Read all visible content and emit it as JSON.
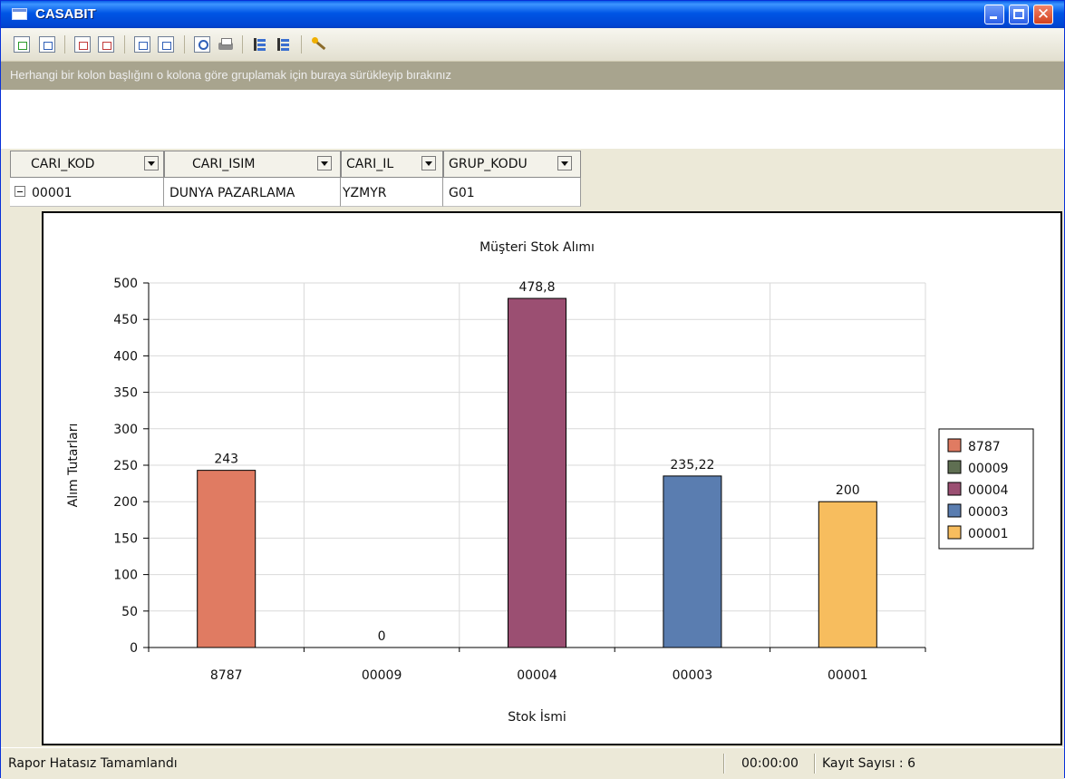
{
  "window": {
    "title": "CASABIT"
  },
  "toolbar": {
    "icons": [
      "export-icon",
      "import-icon",
      "excel-export-icon",
      "excel-export-alt-icon",
      "html-export-icon",
      "html-export-alt-icon",
      "print-preview-icon",
      "print-icon",
      "collapse-tree-icon",
      "expand-tree-icon",
      "wizard-icon"
    ]
  },
  "group_panel": {
    "hint": "Herhangi bir kolon başlığını o kolona göre gruplamak için buraya sürükleyip bırakınız"
  },
  "grid": {
    "columns": [
      "CARI_KOD",
      "CARI_ISIM",
      "CARI_IL",
      "GRUP_KODU"
    ],
    "rows": [
      {
        "cari_kod": "00001",
        "cari_isim": "DUNYA PAZARLAMA",
        "cari_il": "YZMYR",
        "grup_kodu": "G01"
      }
    ]
  },
  "chart_data": {
    "type": "bar",
    "title": "Müşteri Stok Alımı",
    "xlabel": "Stok İsmi",
    "ylabel": "Alım Tutarları",
    "categories": [
      "8787",
      "00009",
      "00004",
      "00003",
      "00001"
    ],
    "values": [
      243,
      0,
      478.8,
      235.22,
      200
    ],
    "value_labels": [
      "243",
      "0",
      "478,8",
      "235,22",
      "200"
    ],
    "colors": [
      "#e07b62",
      "#5f6f52",
      "#9b4f72",
      "#5a7db0",
      "#f7bd5e"
    ],
    "ylim": [
      0,
      500
    ],
    "yticks": [
      0,
      50,
      100,
      150,
      200,
      250,
      300,
      350,
      400,
      450,
      500
    ],
    "grid": true,
    "legend": {
      "position": "right",
      "entries": [
        "8787",
        "00009",
        "00004",
        "00003",
        "00001"
      ]
    }
  },
  "status": {
    "message": "Rapor Hatasız Tamamlandı",
    "time": "00:00:00",
    "record_count": "Kayıt Sayısı :  6"
  }
}
